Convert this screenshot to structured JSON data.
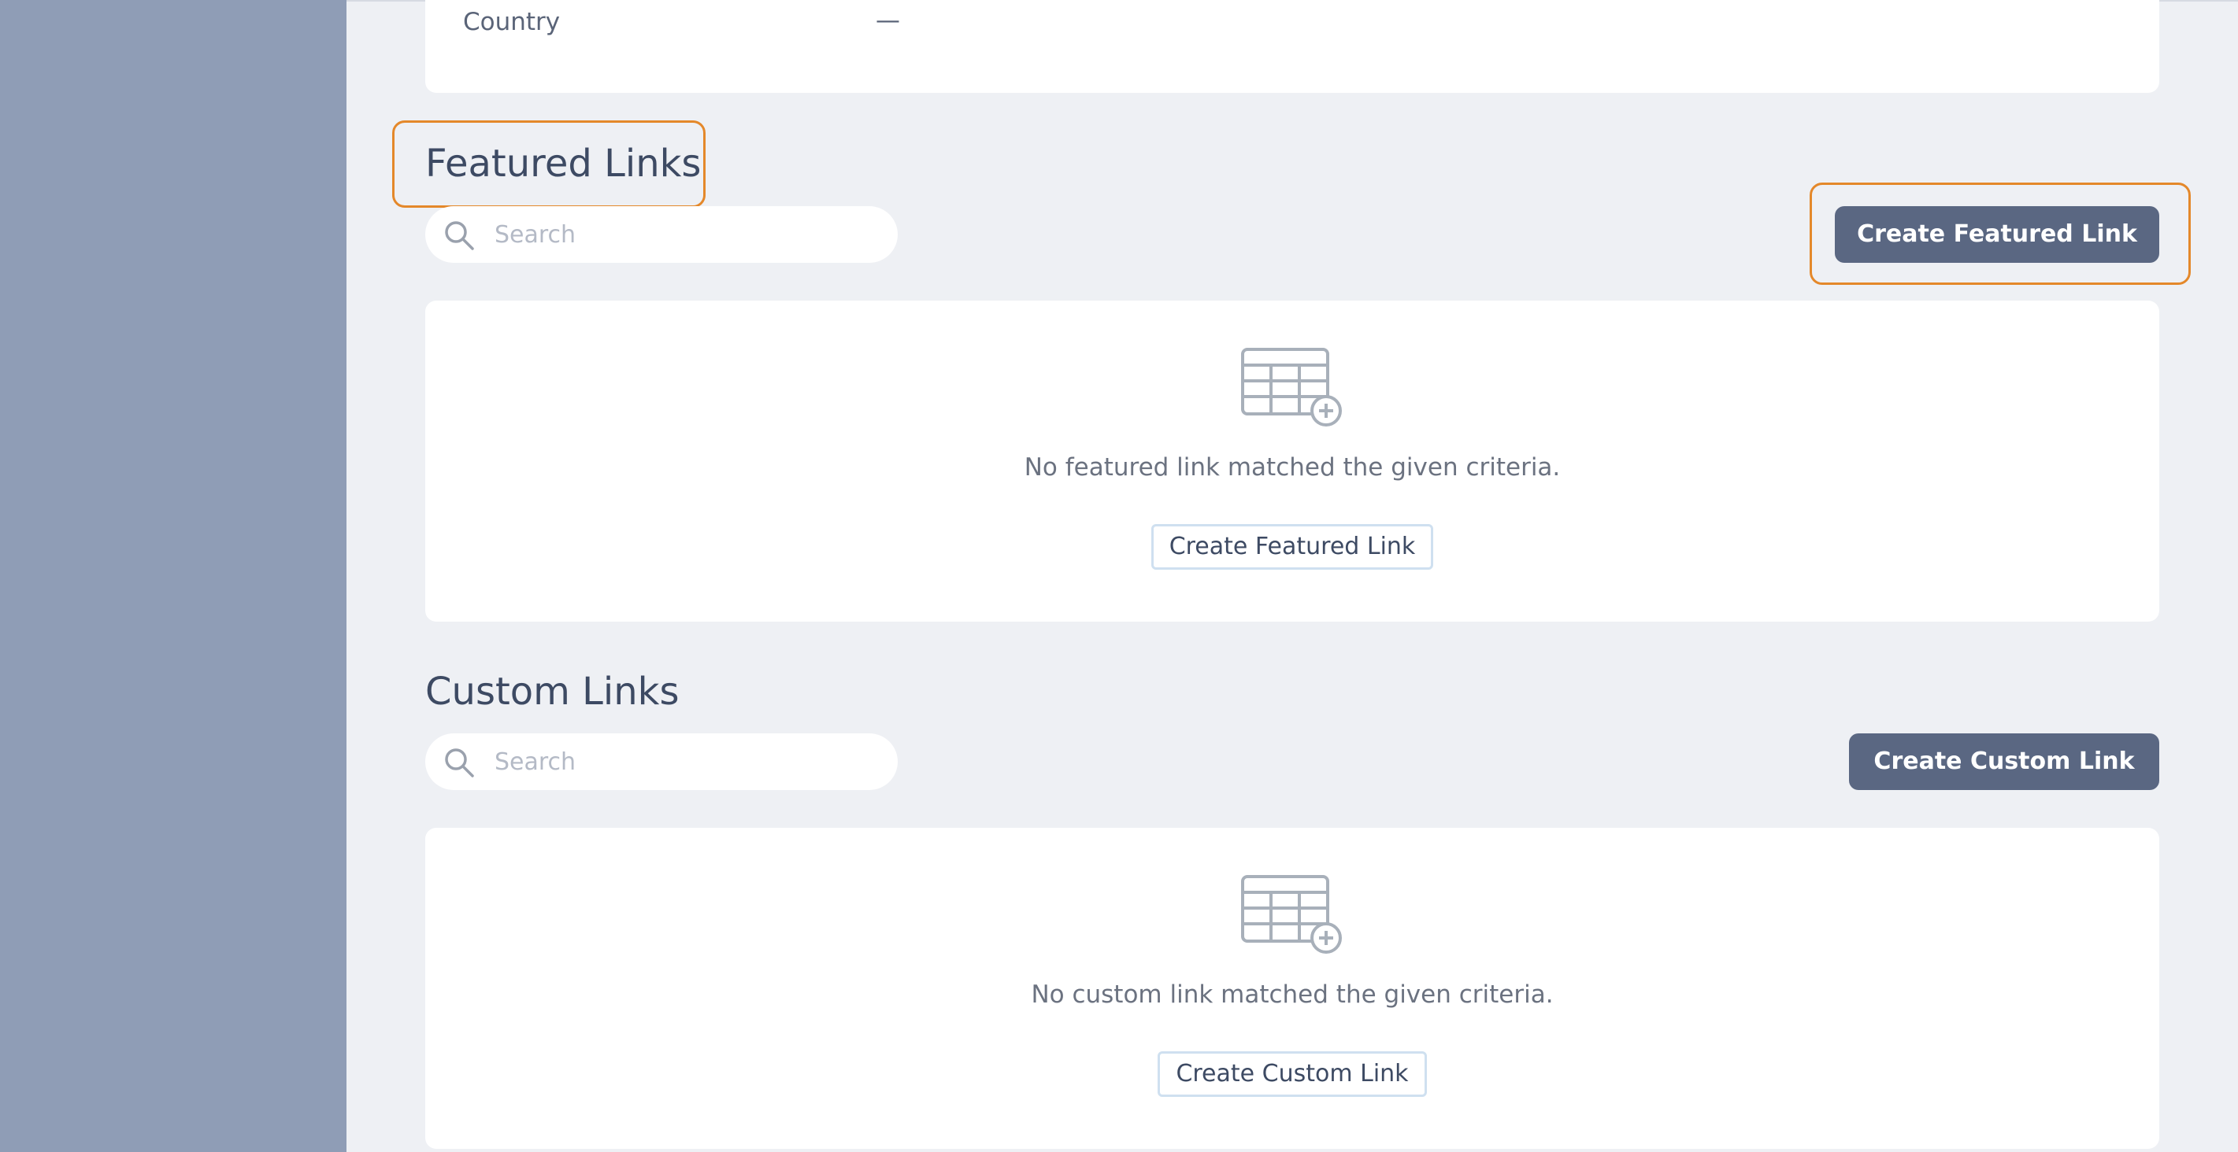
{
  "details": {
    "country_label": "Country",
    "country_value": "—"
  },
  "featured": {
    "title": "Featured Links",
    "search_placeholder": "Search",
    "create_button_label": "Create Featured Link",
    "empty_message": "No featured link matched the given criteria.",
    "empty_create_label": "Create Featured Link"
  },
  "custom": {
    "title": "Custom Links",
    "search_placeholder": "Search",
    "create_button_label": "Create Custom Link",
    "empty_message": "No custom link matched the given criteria.",
    "empty_create_label": "Create Custom Link"
  },
  "colors": {
    "sidebar": "#8f9db6",
    "background": "#eef0f4",
    "primary_button": "#5a6782",
    "highlight": "#e4882a"
  },
  "icons": {
    "search": "search-icon",
    "empty_table": "table-add-icon"
  }
}
